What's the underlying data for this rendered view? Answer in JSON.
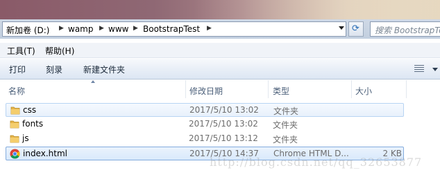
{
  "address": {
    "crumbs": [
      "新加卷 (D:)",
      "wamp",
      "www",
      "BootstrapTest"
    ],
    "search_placeholder": "搜索 BootstrapTest"
  },
  "menu": {
    "items": [
      "工具(T)",
      "帮助(H)"
    ]
  },
  "toolbar": {
    "print_label": "打印",
    "burn_label": "刻录",
    "new_folder_label": "新建文件夹"
  },
  "columns": {
    "name": "名称",
    "date": "修改日期",
    "type": "类型",
    "size": "大小"
  },
  "files": [
    {
      "name": "css",
      "date": "2017/5/10 13:02",
      "type": "文件夹",
      "size": "",
      "icon": "folder-icon"
    },
    {
      "name": "fonts",
      "date": "2017/5/10 13:02",
      "type": "文件夹",
      "size": "",
      "icon": "folder-icon"
    },
    {
      "name": "js",
      "date": "2017/5/10 13:12",
      "type": "文件夹",
      "size": "",
      "icon": "folder-icon"
    },
    {
      "name": "index.html",
      "date": "2017/5/10 14:37",
      "type": "Chrome HTML D...",
      "size": "2 KB",
      "icon": "chrome-icon"
    }
  ],
  "watermark": "http://blog.csdn.net/qq_32653877",
  "colors": {
    "selection_border": "#84acdd",
    "folder": "#e8b84a",
    "accent": "#2a6db6"
  }
}
